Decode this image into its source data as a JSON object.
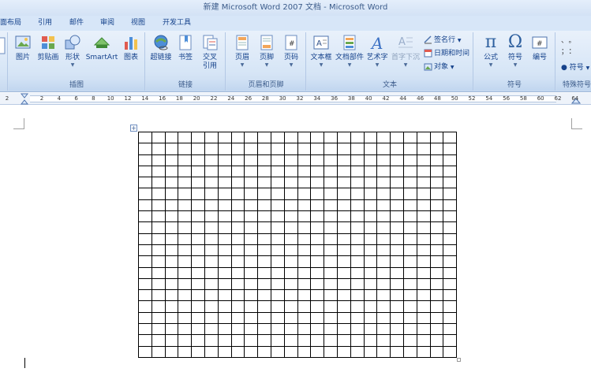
{
  "window": {
    "title": "新建 Microsoft Word 2007 文档 - Microsoft Word"
  },
  "tabs": [
    "面布局",
    "引用",
    "邮件",
    "审阅",
    "视图",
    "开发工具"
  ],
  "ribbon": {
    "groups": [
      {
        "label": "插图",
        "buttons": [
          "图片",
          "剪贴画",
          "形状",
          "SmartArt",
          "图表"
        ]
      },
      {
        "label": "链接",
        "buttons": [
          "超链接",
          "书签",
          "交叉引用"
        ]
      },
      {
        "label": "页眉和页脚",
        "buttons": [
          "页眉",
          "页脚",
          "页码"
        ]
      },
      {
        "label": "文本",
        "buttons": [
          "文本框",
          "文档部件",
          "艺术字",
          "首字下沉"
        ],
        "small_buttons": [
          "签名行",
          "日期和时间",
          "对象"
        ]
      },
      {
        "label": "符号",
        "buttons": [
          "公式",
          "符号",
          "编号"
        ]
      },
      {
        "label": "特殊符号",
        "buttons": [
          "符号"
        ]
      }
    ]
  },
  "ruler": {
    "ticks": [
      "2",
      "2",
      "4",
      "6",
      "8",
      "10",
      "12",
      "14",
      "16",
      "18",
      "20",
      "22",
      "24",
      "26",
      "28",
      "30",
      "32",
      "34",
      "36",
      "38",
      "40",
      "42",
      "44",
      "46",
      "48",
      "50",
      "52",
      "54",
      "56",
      "58",
      "60",
      "62",
      "64"
    ]
  },
  "colors": {
    "ribbon": "#d6e5f6",
    "text": "#15428b",
    "grid_border": "#000000"
  },
  "table": {
    "rows": 20,
    "cols": 24
  }
}
